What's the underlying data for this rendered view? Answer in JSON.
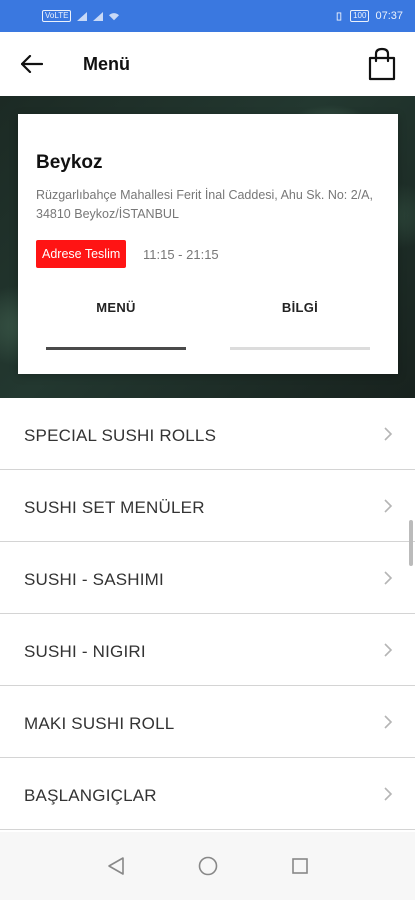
{
  "status_bar": {
    "left_chip": "VoLTE",
    "time": "07:37",
    "battery_label": "100"
  },
  "header": {
    "title": "Menü",
    "back_icon": "arrow-left-icon",
    "cart_icon": "shopping-bag-icon"
  },
  "store": {
    "name": "Beykoz",
    "address": "Rüzgarlıbahçe Mahallesi Ferit İnal Caddesi, Ahu Sk. No: 2/A, 34810 Beykoz/İSTANBUL",
    "delivery_label": "Adrese Teslim",
    "delivery_color": "#ff1414",
    "hours": "11:15 - 21:15"
  },
  "tabs": [
    {
      "label": "MENÜ",
      "active": true
    },
    {
      "label": "BİLGİ",
      "active": false
    }
  ],
  "menu_items": [
    {
      "label": "SPECIAL SUSHI ROLLS"
    },
    {
      "label": "SUSHI SET MENÜLER"
    },
    {
      "label": "SUSHI - SASHIMI"
    },
    {
      "label": "SUSHI - NIGIRI"
    },
    {
      "label": "MAKI SUSHI ROLL"
    },
    {
      "label": "BAŞLANGIÇLAR"
    }
  ],
  "nav": {
    "back": "nav-back-icon",
    "home": "nav-home-icon",
    "recents": "nav-recents-icon"
  },
  "colors": {
    "status_bar": "#3a78e0",
    "active_tab": "#4a4a4a",
    "inactive_tab": "#dcdcdc"
  }
}
